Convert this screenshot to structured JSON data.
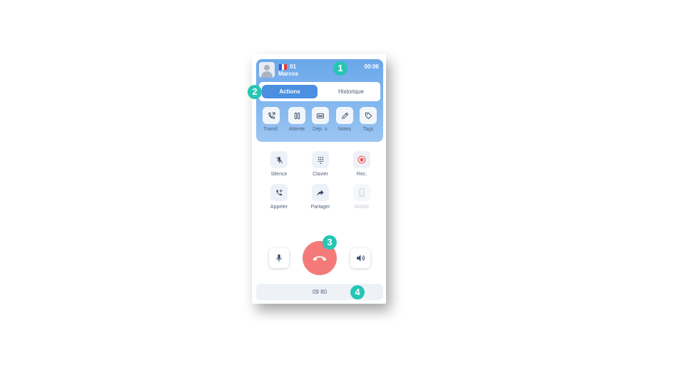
{
  "call": {
    "number": "01",
    "name": "Marcos",
    "timer": "00:06",
    "flag_colors": [
      "#2f5bd0",
      "#ffffff",
      "#e23b3b"
    ]
  },
  "tabs": [
    {
      "label": "Actions",
      "active": true
    },
    {
      "label": "Historique",
      "active": false
    }
  ],
  "header_actions": [
    {
      "label": "Transf.",
      "icon": "transfer-icon"
    },
    {
      "label": "Attente",
      "icon": "pause-icon"
    },
    {
      "label": "Dép. v.",
      "icon": "voicemail-icon"
    },
    {
      "label": "Notes",
      "icon": "pencil-icon"
    },
    {
      "label": "Tags",
      "icon": "tag-icon"
    }
  ],
  "actions": [
    {
      "label": "Silence",
      "icon": "mic-off-icon",
      "enabled": true
    },
    {
      "label": "Clavier",
      "icon": "keypad-icon",
      "enabled": true
    },
    {
      "label": "Rec.",
      "icon": "record-icon",
      "enabled": true
    },
    {
      "label": "Appeler",
      "icon": "phone-add-icon",
      "enabled": true
    },
    {
      "label": "Partager",
      "icon": "share-icon",
      "enabled": true
    },
    {
      "label": "Mobile",
      "icon": "mobile-icon",
      "enabled": false
    }
  ],
  "footer": {
    "number": "09 80"
  },
  "badges": [
    "1",
    "2",
    "3",
    "4"
  ],
  "colors": {
    "accent": "#4a8fe0",
    "hangup": "#f47a7a",
    "badge": "#26c6b4",
    "record": "#ef5a5a"
  }
}
